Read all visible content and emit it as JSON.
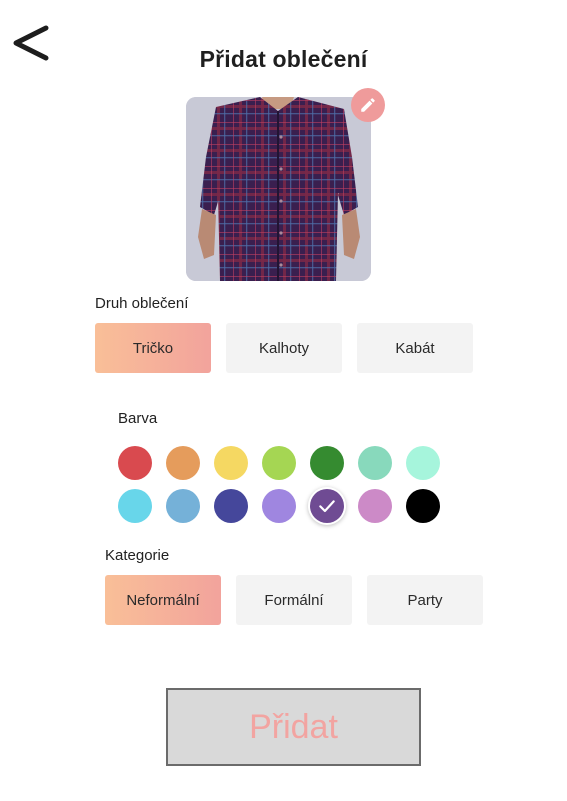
{
  "header": {
    "title": "Přidat oblečení"
  },
  "photo": {
    "alt": "shirt-photo"
  },
  "type_section": {
    "label": "Druh oblečení",
    "options": [
      {
        "label": "Tričko",
        "selected": true
      },
      {
        "label": "Kalhoty",
        "selected": false
      },
      {
        "label": "Kabát",
        "selected": false
      }
    ]
  },
  "color_section": {
    "label": "Barva",
    "colors": [
      {
        "hex": "#d94a4f",
        "selected": false
      },
      {
        "hex": "#e59c5c",
        "selected": false
      },
      {
        "hex": "#f5d862",
        "selected": false
      },
      {
        "hex": "#a5d653",
        "selected": false
      },
      {
        "hex": "#358b30",
        "selected": false
      },
      {
        "hex": "#88d9bc",
        "selected": false
      },
      {
        "hex": "#a6f5dc",
        "selected": false
      },
      {
        "hex": "#68d6ea",
        "selected": false
      },
      {
        "hex": "#75b1d8",
        "selected": false
      },
      {
        "hex": "#45479b",
        "selected": false
      },
      {
        "hex": "#9f86e0",
        "selected": false
      },
      {
        "hex": "#6f4b93",
        "selected": true
      },
      {
        "hex": "#cc8ac7",
        "selected": false
      },
      {
        "hex": "#000000",
        "selected": false
      }
    ]
  },
  "category_section": {
    "label": "Kategorie",
    "options": [
      {
        "label": "Neformální",
        "selected": true
      },
      {
        "label": "Formální",
        "selected": false
      },
      {
        "label": "Party",
        "selected": false
      }
    ]
  },
  "submit": {
    "label": "Přidat"
  },
  "theme": {
    "accent_gradient_start": "#f9bf98",
    "accent_gradient_end": "#f2a39c",
    "edit_badge": "#ef9b9b",
    "submit_text": "#f2a4a1"
  },
  "icons": {
    "back": "chevron-left-icon",
    "edit": "pencil-icon",
    "check": "check-icon"
  }
}
